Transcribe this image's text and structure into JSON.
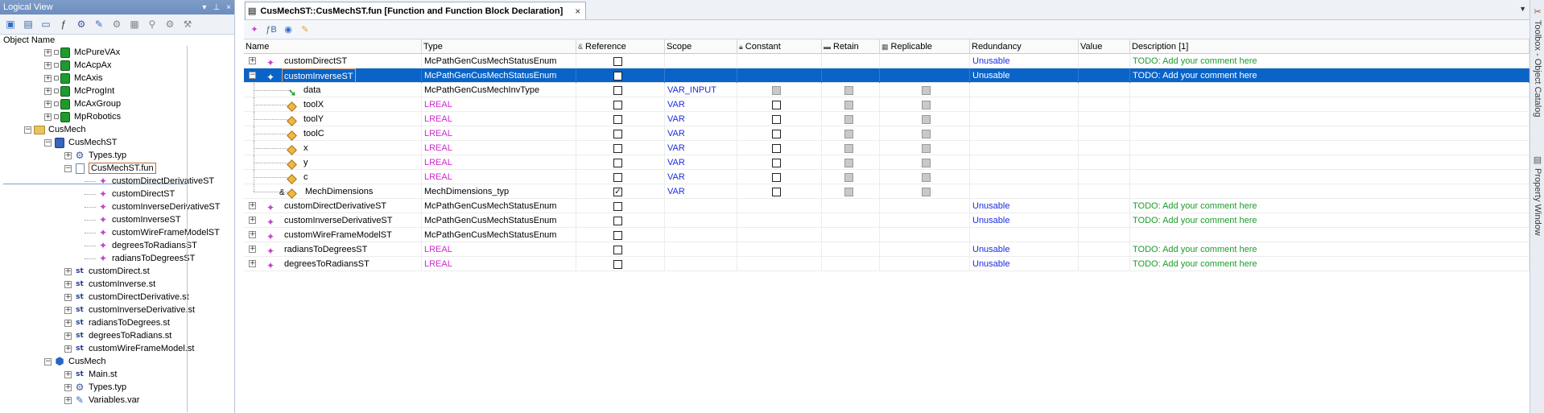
{
  "left_pane": {
    "title": "Logical View",
    "column_header": "Object Name",
    "tree": [
      {
        "label": "McPureVAx",
        "icon": "green-library-icon",
        "expander": "+"
      },
      {
        "label": "McAcpAx",
        "icon": "green-library-icon",
        "expander": "+"
      },
      {
        "label": "McAxis",
        "icon": "green-library-icon",
        "expander": "+"
      },
      {
        "label": "McProgInt",
        "icon": "green-library-icon",
        "expander": "+"
      },
      {
        "label": "McAxGroup",
        "icon": "green-library-icon",
        "expander": "+"
      },
      {
        "label": "MpRobotics",
        "icon": "green-library-icon",
        "expander": "+"
      },
      {
        "label": "CusMech",
        "icon": "folder-icon",
        "expander": "−"
      },
      {
        "label": "CusMechST",
        "icon": "st-library-icon",
        "expander": "−"
      },
      {
        "label": "Types.typ",
        "icon": "types-icon",
        "expander": "+"
      },
      {
        "label": "CusMechST.fun",
        "icon": "function-file-icon",
        "expander": "−"
      },
      {
        "label": "customDirectDerivativeST",
        "icon": "function-icon"
      },
      {
        "label": "customDirectST",
        "icon": "function-icon"
      },
      {
        "label": "customInverseDerivativeST",
        "icon": "function-icon"
      },
      {
        "label": "customInverseST",
        "icon": "function-icon"
      },
      {
        "label": "customWireFrameModelST",
        "icon": "function-icon"
      },
      {
        "label": "degreesToRadiansST",
        "icon": "function-icon"
      },
      {
        "label": "radiansToDegreesST",
        "icon": "function-icon"
      },
      {
        "label": "customDirect.st",
        "icon": "st-file-icon",
        "expander": "+"
      },
      {
        "label": "customInverse.st",
        "icon": "st-file-icon",
        "expander": "+"
      },
      {
        "label": "customDirectDerivative.st",
        "icon": "st-file-icon",
        "expander": "+"
      },
      {
        "label": "customInverseDerivative.st",
        "icon": "st-file-icon",
        "expander": "+"
      },
      {
        "label": "radiansToDegrees.st",
        "icon": "st-file-icon",
        "expander": "+"
      },
      {
        "label": "degreesToRadians.st",
        "icon": "st-file-icon",
        "expander": "+"
      },
      {
        "label": "customWireFrameModel.st",
        "icon": "st-file-icon",
        "expander": "+"
      },
      {
        "label": "CusMech",
        "icon": "package-icon",
        "expander": "−"
      },
      {
        "label": "Main.st",
        "icon": "st-file-icon",
        "expander": "+"
      },
      {
        "label": "Types.typ",
        "icon": "types-icon",
        "expander": "+"
      },
      {
        "label": "Variables.var",
        "icon": "variables-icon",
        "expander": "+"
      }
    ]
  },
  "doc": {
    "tab_title": "CusMechST::CusMechST.fun [Function and Function Block Declaration]",
    "tab_close": "×"
  },
  "grid": {
    "headers": {
      "name": "Name",
      "type": "Type",
      "reference": "Reference",
      "scope": "Scope",
      "constant": "Constant",
      "retain": "Retain",
      "replicable": "Replicable",
      "redundancy": "Redundancy",
      "value": "Value",
      "description": "Description [1]"
    },
    "rows": [
      {
        "name": "customDirectST",
        "type": "McPathGenCusMechStatusEnum",
        "ref": false,
        "scope": "",
        "redundancy": "Unusable",
        "description": "TODO: Add your comment here",
        "level": 0,
        "expander": "+"
      },
      {
        "name": "customInverseST",
        "type": "McPathGenCusMechStatusEnum",
        "ref": false,
        "scope": "",
        "redundancy": "Unusable",
        "description": "TODO: Add your comment here",
        "level": 0,
        "expander": "−",
        "selected": true
      },
      {
        "name": "data",
        "type": "McPathGenCusMechInvType",
        "ref": false,
        "scope": "VAR_INPUT",
        "redundancy": "",
        "description": "",
        "level": 1,
        "icon": "input-arrow"
      },
      {
        "name": "toolX",
        "type": "LREAL",
        "ref": false,
        "scope": "VAR",
        "redundancy": "",
        "description": "",
        "level": 1
      },
      {
        "name": "toolY",
        "type": "LREAL",
        "ref": false,
        "scope": "VAR",
        "redundancy": "",
        "description": "",
        "level": 1
      },
      {
        "name": "toolC",
        "type": "LREAL",
        "ref": false,
        "scope": "VAR",
        "redundancy": "",
        "description": "",
        "level": 1
      },
      {
        "name": "x",
        "type": "LREAL",
        "ref": false,
        "scope": "VAR",
        "redundancy": "",
        "description": "",
        "level": 1
      },
      {
        "name": "y",
        "type": "LREAL",
        "ref": false,
        "scope": "VAR",
        "redundancy": "",
        "description": "",
        "level": 1
      },
      {
        "name": "c",
        "type": "LREAL",
        "ref": false,
        "scope": "VAR",
        "redundancy": "",
        "description": "",
        "level": 1
      },
      {
        "name": "MechDimensions",
        "type": "MechDimensions_typ",
        "ref": true,
        "scope": "VAR",
        "redundancy": "",
        "description": "",
        "level": 1,
        "ref_mark": "&"
      },
      {
        "name": "customDirectDerivativeST",
        "type": "McPathGenCusMechStatusEnum",
        "ref": false,
        "scope": "",
        "redundancy": "Unusable",
        "description": "TODO: Add your comment here",
        "level": 0,
        "expander": "+"
      },
      {
        "name": "customInverseDerivativeST",
        "type": "McPathGenCusMechStatusEnum",
        "ref": false,
        "scope": "",
        "redundancy": "Unusable",
        "description": "TODO: Add your comment here",
        "level": 0,
        "expander": "+"
      },
      {
        "name": "customWireFrameModelST",
        "type": "McPathGenCusMechStatusEnum",
        "ref": false,
        "scope": "",
        "redundancy": "",
        "description": "",
        "level": 0,
        "expander": "+"
      },
      {
        "name": "radiansToDegreesST",
        "type": "LREAL",
        "ref": false,
        "scope": "",
        "redundancy": "Unusable",
        "description": "TODO: Add your comment here",
        "level": 0,
        "expander": "+"
      },
      {
        "name": "degreesToRadiansST",
        "type": "LREAL",
        "ref": false,
        "scope": "",
        "redundancy": "Unusable",
        "description": "TODO: Add your comment here",
        "level": 0,
        "expander": "+"
      }
    ]
  },
  "right_dock": {
    "tab1": "Toolbox - Object Catalog",
    "tab2": "Property Window"
  },
  "colors": {
    "selection": "#0a64c8",
    "lreal": "#d02ad0",
    "scope": "#1a2de0",
    "todo": "#1b9c2a"
  }
}
